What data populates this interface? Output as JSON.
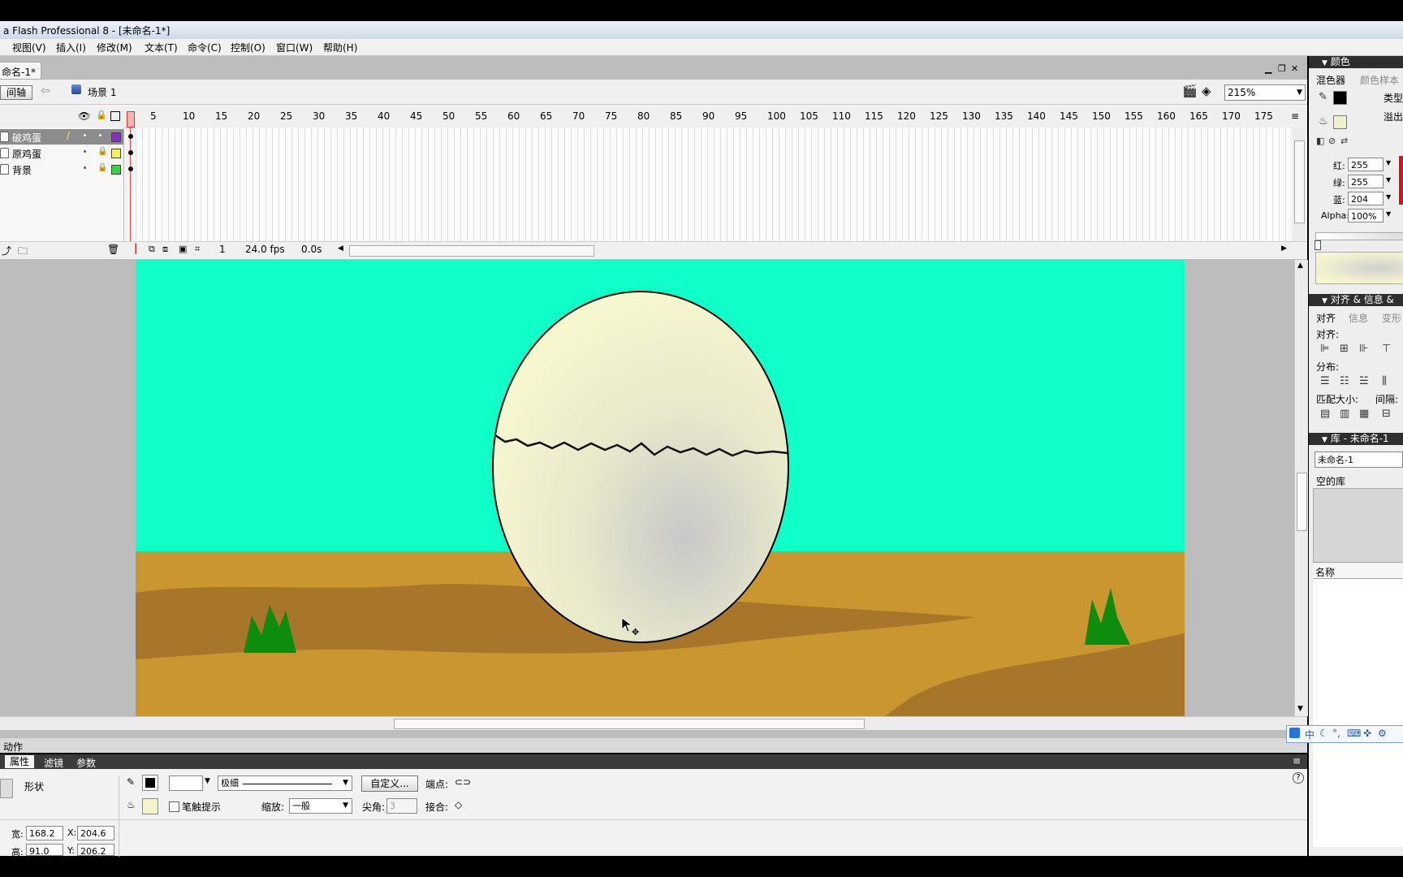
{
  "title": "a Flash Professional 8 - [未命名-1*]",
  "menu": [
    "视图(V)",
    "插入(I)",
    "修改(M)",
    "文本(T)",
    "命令(C)",
    "控制(O)",
    "窗口(W)",
    "帮助(H)"
  ],
  "doc_tab": "命名-1*",
  "timeline_button": "间轴",
  "scene_label": "场景 1",
  "zoom": "215%",
  "frame_ruler": [
    "5",
    "10",
    "15",
    "20",
    "25",
    "30",
    "35",
    "40",
    "45",
    "50",
    "55",
    "60",
    "65",
    "70",
    "75",
    "80",
    "85",
    "90",
    "95",
    "100",
    "105",
    "110",
    "115",
    "120",
    "125",
    "130",
    "135",
    "140",
    "145",
    "150",
    "155",
    "160",
    "165",
    "170",
    "175"
  ],
  "layers": [
    {
      "name": "破鸡蛋",
      "color": "#8a2cc8"
    },
    {
      "name": "原鸡蛋",
      "color": "#f3f060"
    },
    {
      "name": "背景",
      "color": "#39d439"
    }
  ],
  "timeline_status": {
    "frame": "1",
    "fps": "24.0 fps",
    "time": "0.0s"
  },
  "stage": {
    "sky_color": "#10fec8",
    "ground_color": "#c9962f",
    "egg_color": "#fbfbd0"
  },
  "panels": {
    "actions": "动作",
    "tabs": [
      "属性",
      "滤镜",
      "参数"
    ],
    "shape_label": "形状",
    "stroke_style": "极细",
    "custom_button": "自定义...",
    "cap_label": "端点:",
    "stroke_hint": "笔触提示",
    "scale_label": "缩放:",
    "scale_value": "一般",
    "miter_label": "尖角:",
    "miter_value": "3",
    "join_label": "接合:",
    "w_label": "宽:",
    "w_value": "168.2",
    "x_label": "X:",
    "x_value": "204.6",
    "h_label": "高:",
    "h_value": "91.0",
    "y_label": "Y:",
    "y_value": "206.2"
  },
  "color_panel": {
    "title": "颜色",
    "tabs": [
      "混色器",
      "颜色样本"
    ],
    "type_label": "类型",
    "overflow_label": "溢出",
    "red_label": "红:",
    "red": "255",
    "green_label": "绿:",
    "green": "255",
    "blue_label": "蓝:",
    "blue": "204",
    "alpha_label": "Alpha:",
    "alpha": "100%"
  },
  "align_panel": {
    "title": "对齐 & 信息 &",
    "tabs": [
      "对齐",
      "信息",
      "变形"
    ],
    "align": "对齐:",
    "distribute": "分布:",
    "match_size": "匹配大小:",
    "spacing": "间隔:"
  },
  "library_panel": {
    "title": "库 - 未命名-1",
    "dropdown": "未命名-1",
    "empty": "空的库",
    "name_col": "名称"
  },
  "ime": "中"
}
